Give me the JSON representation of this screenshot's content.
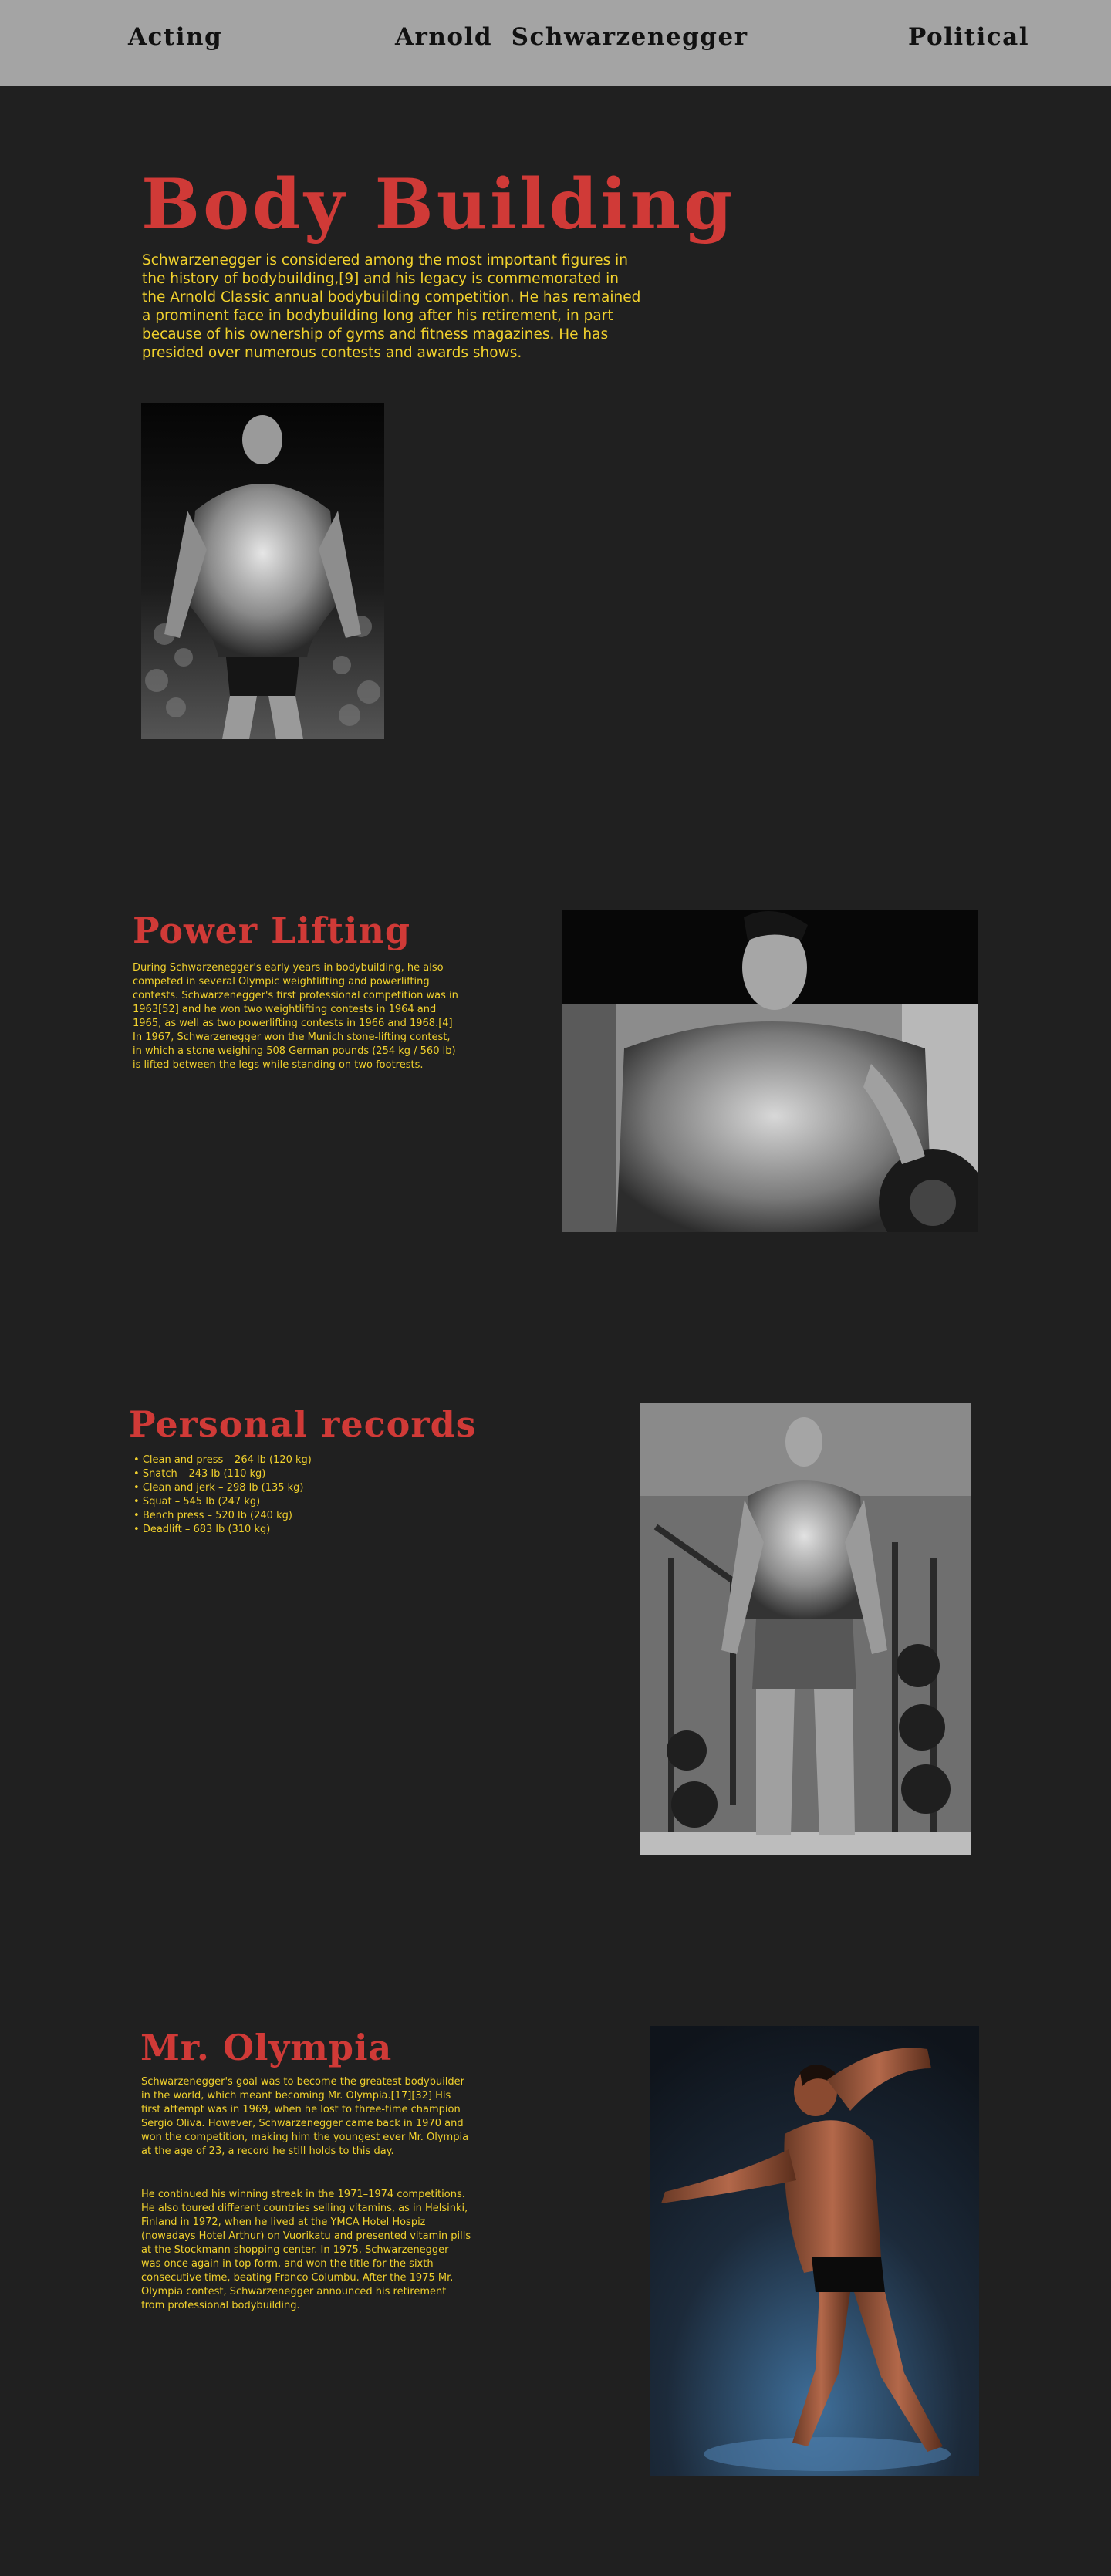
{
  "nav": {
    "left_link": "Acting",
    "title": "Arnold  Schwarzenegger",
    "right_link": "Political"
  },
  "body_building": {
    "heading": "Body Building",
    "text": "Schwarzenegger is considered among the most important figures in the history of bodybuilding,[9] and his legacy is commemorated in the Arnold Classic annual bodybuilding competition. He has remained a prominent face in bodybuilding long after his retirement, in part because of his ownership of gyms and fitness magazines. He has presided over numerous contests and awards shows."
  },
  "power_lifting": {
    "heading": "Power Lifting",
    "text": "During Schwarzenegger's early years in bodybuilding, he also competed in several Olympic weightlifting and powerlifting contests. Schwarzenegger's first professional competition was in 1963[52] and he won two weightlifting contests in 1964 and 1965, as well as two powerlifting contests in 1966 and 1968.[4] In 1967, Schwarzenegger won the Munich stone-lifting contest, in which a stone weighing 508 German pounds (254 kg / 560 lb) is lifted between the legs while standing on two footrests."
  },
  "personal_records": {
    "heading": "Personal records",
    "items": [
      "Clean and press – 264 lb (120 kg)",
      "Snatch – 243 lb (110 kg)",
      "Clean and jerk – 298 lb (135 kg)",
      "Squat – 545 lb (247 kg)",
      "Bench press – 520 lb (240 kg)",
      "Deadlift – 683 lb (310 kg)"
    ]
  },
  "mr_olympia": {
    "heading": "Mr. Olympia",
    "text_1": "Schwarzenegger's goal was to become the greatest bodybuilder in the world, which meant becoming Mr. Olympia.[17][32] His first attempt was in 1969, when he lost to three-time champion Sergio Oliva. However, Schwarzenegger came back in 1970 and won the competition, making him the youngest ever Mr. Olympia at the age of 23, a record he still holds to this day.",
    "text_2": "He continued his winning streak in the 1971–1974 competitions. He also toured different countries selling vitamins, as in Helsinki, Finland in 1972, when he lived at the YMCA Hotel Hospiz (nowadays Hotel Arthur) on Vuorikatu and presented vitamin pills at the Stockmann shopping center. In 1975, Schwarzenegger was once again in top form, and won the title for the sixth consecutive time, beating Franco Columbu. After the 1975 Mr. Olympia contest, Schwarzenegger announced his retirement from professional bodybuilding."
  }
}
